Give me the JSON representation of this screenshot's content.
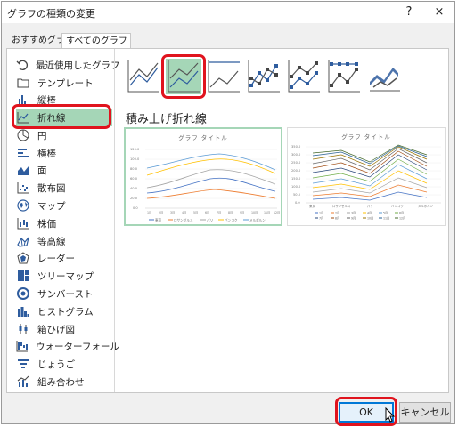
{
  "dialog": {
    "title": "グラフの種類の変更",
    "help": "?",
    "close": "×"
  },
  "tabs": [
    {
      "label": "おすすめグラフ",
      "active": false
    },
    {
      "label": "すべてのグラフ",
      "active": true
    }
  ],
  "sidebar": {
    "items": [
      {
        "label": "最近使用したグラフ",
        "icon": "recent-icon"
      },
      {
        "label": "テンプレート",
        "icon": "folder-icon"
      },
      {
        "label": "縦棒",
        "icon": "column-chart-icon"
      },
      {
        "label": "折れ線",
        "icon": "line-chart-icon",
        "selected": true
      },
      {
        "label": "円",
        "icon": "pie-chart-icon"
      },
      {
        "label": "横棒",
        "icon": "bar-chart-icon"
      },
      {
        "label": "面",
        "icon": "area-chart-icon"
      },
      {
        "label": "散布図",
        "icon": "scatter-chart-icon"
      },
      {
        "label": "マップ",
        "icon": "map-icon"
      },
      {
        "label": "株価",
        "icon": "stock-chart-icon"
      },
      {
        "label": "等高線",
        "icon": "surface-chart-icon"
      },
      {
        "label": "レーダー",
        "icon": "radar-chart-icon"
      },
      {
        "label": "ツリーマップ",
        "icon": "treemap-icon"
      },
      {
        "label": "サンバースト",
        "icon": "sunburst-icon"
      },
      {
        "label": "ヒストグラム",
        "icon": "histogram-icon"
      },
      {
        "label": "箱ひげ図",
        "icon": "box-whisker-icon"
      },
      {
        "label": "ウォーターフォール",
        "icon": "waterfall-icon"
      },
      {
        "label": "じょうご",
        "icon": "funnel-icon"
      },
      {
        "label": "組み合わせ",
        "icon": "combo-chart-icon"
      }
    ]
  },
  "subtypes": [
    "line",
    "stacked-line",
    "100-stacked-line",
    "line-markers",
    "stacked-line-markers",
    "100-stacked-line-markers",
    "3d-line"
  ],
  "selected_subtype_label": "積み上げ折れ線",
  "preview_left": {
    "title": "グラフ タイトル",
    "y_ticks": [
      "120.0",
      "100.0",
      "80.0",
      "60.0",
      "40.0",
      "20.0",
      "0.0"
    ],
    "x_ticks": [
      "1月",
      "2月",
      "3月",
      "4月",
      "5月",
      "6月",
      "7月",
      "8月",
      "9月",
      "10月",
      "11月",
      "12月"
    ],
    "legend": [
      "東京",
      "ロサンゼルス",
      "パリ",
      "バンコク",
      "メルボルン"
    ]
  },
  "preview_right": {
    "title": "グラフ タイトル",
    "y_ticks": [
      "350.0",
      "300.0",
      "250.0",
      "200.0",
      "150.0",
      "100.0",
      "50.0",
      "0.0"
    ],
    "x_ticks": [
      "東京",
      "ロサンゼルス",
      "パリ",
      "バンコク",
      "メルボルン"
    ],
    "legend": [
      "1月",
      "2月",
      "3月",
      "4月",
      "5月",
      "6月",
      "7月",
      "8月",
      "9月",
      "10月",
      "11月",
      "12月"
    ]
  },
  "colors": {
    "accent_green": "#a5d6b7",
    "highlight_red": "#e0141e",
    "ok_border": "#0078d7",
    "series": [
      "#4472c4",
      "#ed7d31",
      "#a5a5a5",
      "#ffc000",
      "#5b9bd5",
      "#70ad47",
      "#264478",
      "#9e480e",
      "#636363",
      "#997300",
      "#255e91",
      "#43682b"
    ]
  },
  "buttons": {
    "ok": "OK",
    "cancel": "キャンセル"
  }
}
